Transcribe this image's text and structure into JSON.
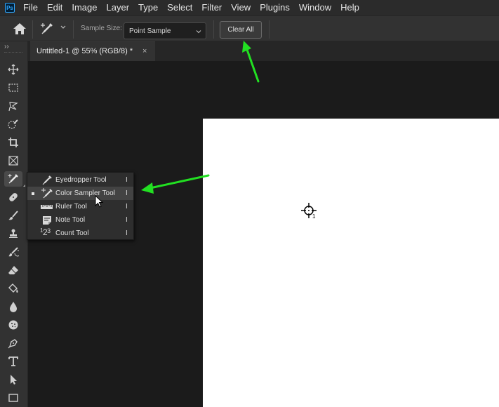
{
  "menubar": {
    "logo": "Ps",
    "items": [
      "File",
      "Edit",
      "Image",
      "Layer",
      "Type",
      "Select",
      "Filter",
      "View",
      "Plugins",
      "Window",
      "Help"
    ]
  },
  "options": {
    "home_icon": "home-icon",
    "tool_icon": "color-sampler-icon",
    "sample_size_label": "Sample Size:",
    "sample_size_value": "Point Sample",
    "clear_all_label": "Clear All"
  },
  "document_tab": {
    "title": "Untitled-1 @ 55% (RGB/8) *",
    "close": "×"
  },
  "toolbar": {
    "collapse": "››",
    "tools": [
      "move-icon",
      "rectangular-marquee-icon",
      "lasso-icon",
      "quick-selection-icon",
      "crop-icon",
      "frame-icon",
      "eyedropper-icon",
      "healing-brush-icon",
      "brush-icon",
      "clone-stamp-icon",
      "history-brush-icon",
      "eraser-icon",
      "paint-bucket-icon",
      "blur-icon",
      "sponge-icon",
      "pen-icon",
      "type-icon",
      "path-selection-icon",
      "rectangle-icon"
    ]
  },
  "flyout": {
    "items": [
      {
        "label": "Eyedropper Tool",
        "shortcut": "I",
        "icon": "eyedropper-icon"
      },
      {
        "label": "Color Sampler Tool",
        "shortcut": "I",
        "icon": "color-sampler-icon"
      },
      {
        "label": "Ruler Tool",
        "shortcut": "I",
        "icon": "ruler-icon"
      },
      {
        "label": "Note Tool",
        "shortcut": "I",
        "icon": "note-icon"
      },
      {
        "label": "Count Tool",
        "shortcut": "I",
        "icon": "count-icon"
      }
    ],
    "count_icon_text": "123"
  },
  "canvas": {
    "sampler_number": "1"
  },
  "colors": {
    "annotation_arrow": "#22e022",
    "document": "#ffffff",
    "workspace": "#1b1b1b"
  }
}
